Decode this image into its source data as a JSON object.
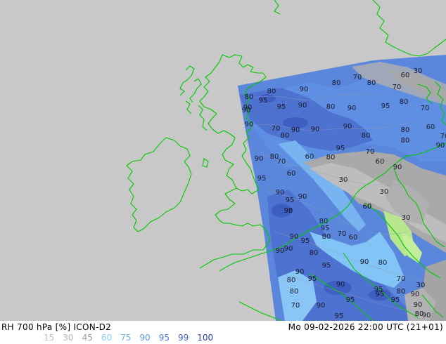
{
  "footer": {
    "left_title": "RH 700 hPa [%] ICON-D2",
    "right_time": "Mo 09-02-2026 22:00 UTC (21+01)"
  },
  "legend": [
    {
      "label": "15",
      "color": "#c0c0c0"
    },
    {
      "label": "30",
      "color": "#b4b4b4"
    },
    {
      "label": "45",
      "color": "#a0a0a0"
    },
    {
      "label": "60",
      "color": "#87cefa"
    },
    {
      "label": "75",
      "color": "#6cb0f0"
    },
    {
      "label": "90",
      "color": "#5a96e6"
    },
    {
      "label": "95",
      "color": "#4a7ad8"
    },
    {
      "label": "99",
      "color": "#3c5ec8"
    },
    {
      "label": "100",
      "color": "#2a40b0"
    }
  ],
  "map": {
    "background_color": "#c8c8c8",
    "coastline_color": "#00c800",
    "contour_labels": [
      "80",
      "95",
      "90",
      "80",
      "70",
      "80",
      "70",
      "30",
      "60",
      "80",
      "90",
      "95",
      "90",
      "80",
      "90",
      "95",
      "80",
      "70",
      "90",
      "70",
      "90",
      "90",
      "90",
      "90",
      "80",
      "60",
      "80",
      "80",
      "70",
      "80",
      "90",
      "90",
      "80",
      "60",
      "95",
      "70",
      "80",
      "70",
      "60",
      "90",
      "60",
      "30",
      "95",
      "90",
      "60",
      "95",
      "90",
      "60",
      "30",
      "90",
      "95",
      "80",
      "30",
      "70",
      "60",
      "90",
      "95",
      "95",
      "80",
      "90",
      "90",
      "80",
      "90",
      "95",
      "80",
      "90",
      "95",
      "90",
      "80",
      "95",
      "80",
      "70",
      "80",
      "95",
      "95",
      "95",
      "90",
      "30",
      "70",
      "90",
      "90",
      "80",
      "95",
      "90"
    ]
  }
}
